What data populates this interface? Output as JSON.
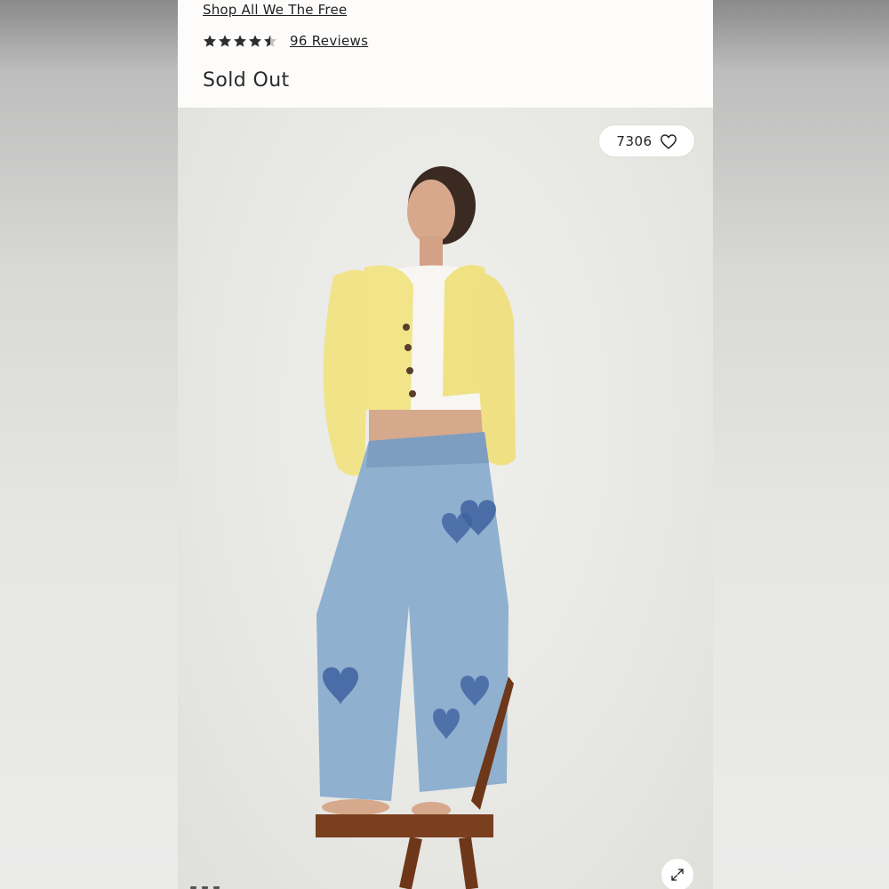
{
  "product": {
    "brand_link": "Shop All We The Free",
    "rating": 4.5,
    "reviews_link": "96 Reviews",
    "status": "Sold Out"
  },
  "gallery": {
    "favorites_count": "7306",
    "favorite_icon": "heart-icon",
    "expand_icon": "expand-icon",
    "image_description_colors": {
      "cardigan": "#f2e489",
      "denim": "#8fb0cf",
      "heart_patches": "#3e62a0",
      "chair": "#7a3f1f"
    }
  }
}
